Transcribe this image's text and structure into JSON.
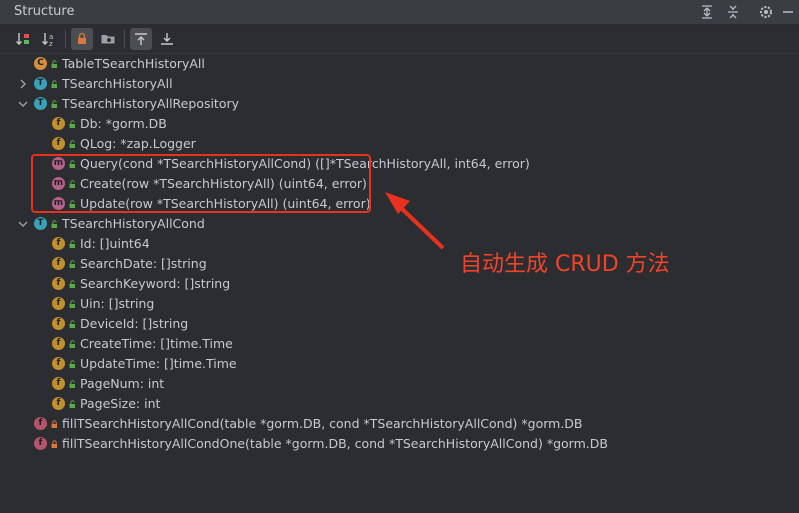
{
  "panel": {
    "title": "Structure"
  },
  "tree": [
    {
      "id": "r0",
      "depth": 1,
      "kind": "c",
      "access": "public",
      "expand": "none",
      "text": "TableTSearchHistoryAll"
    },
    {
      "id": "r1",
      "depth": 1,
      "kind": "t",
      "access": "public",
      "expand": "collapsed",
      "text": "TSearchHistoryAll"
    },
    {
      "id": "r2",
      "depth": 1,
      "kind": "t",
      "access": "public",
      "expand": "expanded",
      "text": "TSearchHistoryAllRepository"
    },
    {
      "id": "r3",
      "depth": 2,
      "kind": "f",
      "access": "public",
      "expand": "none",
      "text": "Db: *gorm.DB"
    },
    {
      "id": "r4",
      "depth": 2,
      "kind": "f",
      "access": "public",
      "expand": "none",
      "text": "QLog: *zap.Logger"
    },
    {
      "id": "r5",
      "depth": 2,
      "kind": "m",
      "access": "public",
      "expand": "none",
      "text": "Query(cond *TSearchHistoryAllCond) ([]*TSearchHistoryAll, int64, error)"
    },
    {
      "id": "r6",
      "depth": 2,
      "kind": "m",
      "access": "public",
      "expand": "none",
      "text": "Create(row *TSearchHistoryAll) (uint64, error)"
    },
    {
      "id": "r7",
      "depth": 2,
      "kind": "m",
      "access": "public",
      "expand": "none",
      "text": "Update(row *TSearchHistoryAll) (uint64, error)"
    },
    {
      "id": "r8",
      "depth": 1,
      "kind": "t",
      "access": "public",
      "expand": "expanded",
      "text": "TSearchHistoryAllCond"
    },
    {
      "id": "r9",
      "depth": 2,
      "kind": "f",
      "access": "public",
      "expand": "none",
      "text": "Id: []uint64"
    },
    {
      "id": "r10",
      "depth": 2,
      "kind": "f",
      "access": "public",
      "expand": "none",
      "text": "SearchDate: []string"
    },
    {
      "id": "r11",
      "depth": 2,
      "kind": "f",
      "access": "public",
      "expand": "none",
      "text": "SearchKeyword: []string"
    },
    {
      "id": "r12",
      "depth": 2,
      "kind": "f",
      "access": "public",
      "expand": "none",
      "text": "Uin: []string"
    },
    {
      "id": "r13",
      "depth": 2,
      "kind": "f",
      "access": "public",
      "expand": "none",
      "text": "DeviceId: []string"
    },
    {
      "id": "r14",
      "depth": 2,
      "kind": "f",
      "access": "public",
      "expand": "none",
      "text": "CreateTime: []time.Time"
    },
    {
      "id": "r15",
      "depth": 2,
      "kind": "f",
      "access": "public",
      "expand": "none",
      "text": "UpdateTime: []time.Time"
    },
    {
      "id": "r16",
      "depth": 2,
      "kind": "f",
      "access": "public",
      "expand": "none",
      "text": "PageNum: int"
    },
    {
      "id": "r17",
      "depth": 2,
      "kind": "f",
      "access": "public",
      "expand": "none",
      "text": "PageSize: int"
    },
    {
      "id": "r18",
      "depth": 0,
      "kind": "fn",
      "access": "private",
      "expand": "none",
      "text": "fillTSearchHistoryAllCond(table *gorm.DB, cond *TSearchHistoryAllCond) *gorm.DB"
    },
    {
      "id": "r19",
      "depth": 0,
      "kind": "fn",
      "access": "private",
      "expand": "none",
      "text": "fillTSearchHistoryAllCondOne(table *gorm.DB, cond *TSearchHistoryAllCond) *gorm.DB"
    }
  ],
  "annotation": {
    "text": "自动生成 CRUD 方法",
    "color": "#f2432a"
  }
}
